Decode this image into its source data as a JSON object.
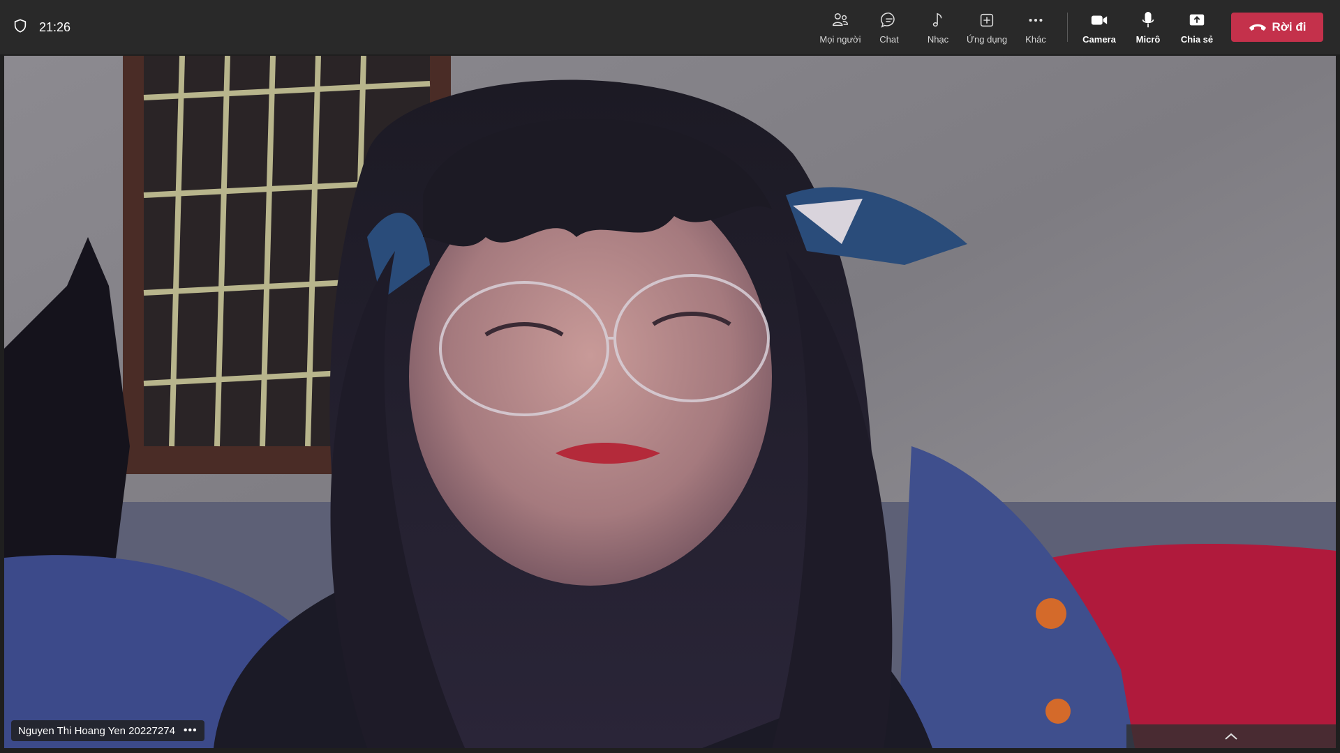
{
  "status": {
    "time": "21:26",
    "shield_icon": "shield-icon"
  },
  "controls": {
    "people": {
      "label": "Mọi người",
      "icon": "people-icon"
    },
    "chat": {
      "label": "Chat",
      "icon": "chat-icon"
    },
    "music": {
      "label": "Nhạc",
      "icon": "music-note-icon"
    },
    "apps": {
      "label": "Ứng dụng",
      "icon": "plus-square-icon"
    },
    "more": {
      "label": "Khác",
      "icon": "ellipsis-icon"
    },
    "camera": {
      "label": "Camera",
      "icon": "camera-icon"
    },
    "mic": {
      "label": "Micrô",
      "icon": "microphone-icon"
    },
    "share": {
      "label": "Chia sẻ",
      "icon": "share-screen-icon"
    },
    "leave": {
      "label": "Rời đi",
      "icon": "phone-hangup-icon",
      "color": "#c4314b"
    }
  },
  "participant": {
    "name": "Nguyen Thi Hoang Yen 20227274",
    "more_glyph": "•••"
  },
  "tray": {
    "icon": "chevron-up-icon"
  }
}
